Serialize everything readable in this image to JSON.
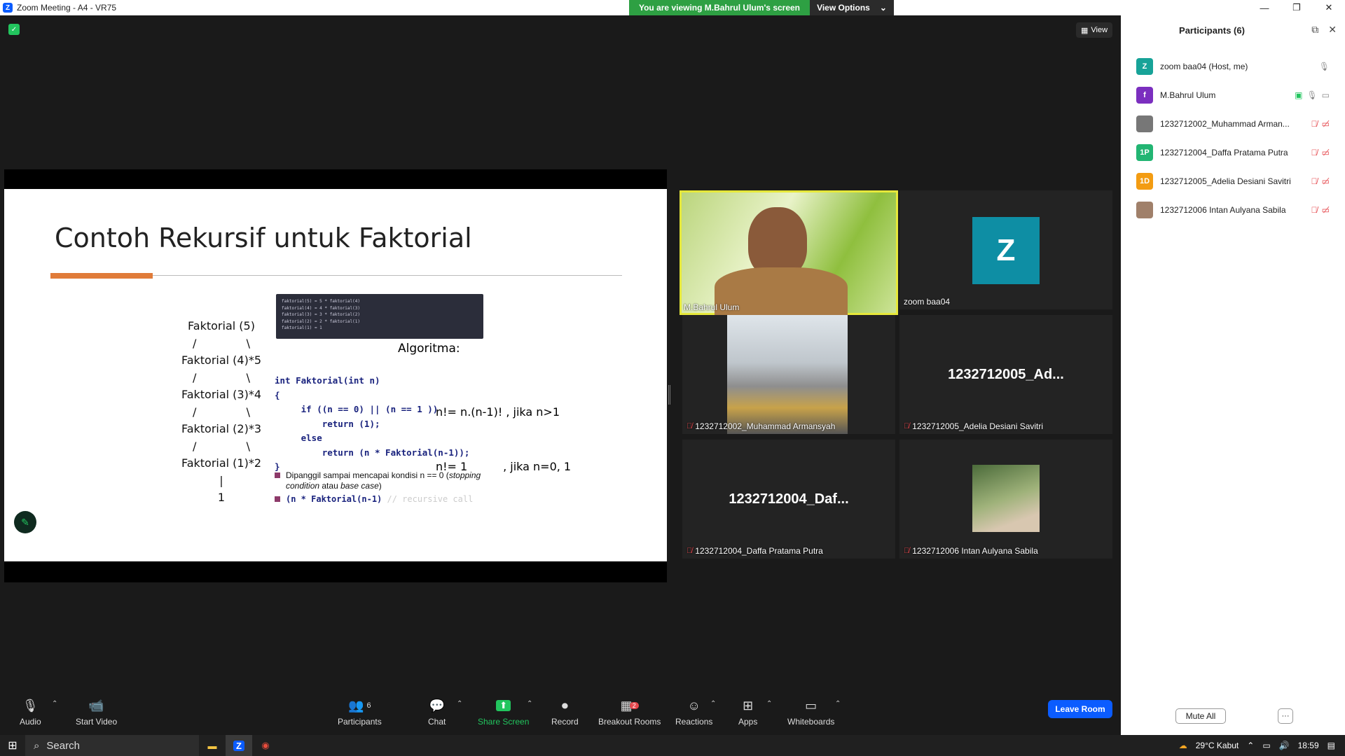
{
  "window": {
    "title": "Zoom Meeting - A4 - VR75",
    "viewing_banner": "You are viewing M.Bahrul Ulum's screen",
    "view_options": "View Options",
    "view_button": "View"
  },
  "slide": {
    "title": "Contoh Rekursif untuk Faktorial",
    "tree": [
      "Faktorial (5)",
      "/              \\",
      "Faktorial (4)*5",
      "/              \\",
      "Faktorial (3)*4",
      "/              \\",
      "Faktorial (2)*3",
      "/              \\",
      "Faktorial (1)*2",
      "|",
      "1"
    ],
    "code_image_lines": [
      "faktorial(5) = 5 * faktorial(4)",
      "faktorial(4) = 4 * faktorial(3)",
      "faktorial(3) = 3 * faktorial(2)",
      "faktorial(2) = 2 * faktorial(1)",
      "faktorial(1) = 1"
    ],
    "algoritma": "Algoritma:",
    "formula_1": "n!= n.(n-1)! , jika n>1",
    "formula_2": "n!= 1          , jika n=0, 1",
    "code": "int Faktorial(int n)\n{\n     if ((n == 0) || (n == 1 ))\n         return (1);\n     else\n         return (n * Faktorial(n-1));\n}",
    "bullet_1_a": "Dipanggil sampai mencapai kondisi n == 0 (",
    "bullet_1_b": "stopping condition",
    "bullet_1_c": " atau ",
    "bullet_1_d": "base case",
    "bullet_1_e": ")",
    "bullet_2_code": "(n * Faktorial(n-1)",
    "bullet_2_comment": " // recursive call"
  },
  "tiles": [
    {
      "name": "M.Bahrul Ulum",
      "muted": false
    },
    {
      "name": "zoom baa04",
      "muted": false,
      "initial": "Z"
    },
    {
      "name": "1232712002_Muhammad Armansyah",
      "muted": true
    },
    {
      "name": "1232712005_Adelia Desiani Savitri",
      "muted": true,
      "big": "1232712005_Ad..."
    },
    {
      "name": "1232712004_Daffa Pratama Putra",
      "muted": true,
      "big": "1232712004_Daf..."
    },
    {
      "name": "1232712006 Intan Aulyana Sabila",
      "muted": true
    }
  ],
  "toolbar": {
    "audio": "Audio",
    "start_video": "Start Video",
    "participants": "Participants",
    "participants_count": "6",
    "chat": "Chat",
    "share_screen": "Share Screen",
    "record": "Record",
    "breakout_rooms": "Breakout Rooms",
    "breakout_badge": "2",
    "reactions": "Reactions",
    "apps": "Apps",
    "whiteboards": "Whiteboards",
    "leave": "Leave Room"
  },
  "panel": {
    "title": "Participants (6)",
    "mute_all": "Mute All",
    "more": "···",
    "participants": [
      {
        "name": "zoom baa04 (Host, me)",
        "initial": "Z",
        "color": "#17a398"
      },
      {
        "name": "M.Bahrul Ulum",
        "initial": "f",
        "color": "#7b2fbf"
      },
      {
        "name": "1232712002_Muhammad Arman...",
        "initial": "",
        "color": "#777"
      },
      {
        "name": "1232712004_Daffa Pratama Putra",
        "initial": "1P",
        "color": "#22b573"
      },
      {
        "name": "1232712005_Adelia Desiani Savitri",
        "initial": "1D",
        "color": "#f39c12"
      },
      {
        "name": "1232712006 Intan Aulyana Sabila",
        "initial": "",
        "color": "#a0806a"
      }
    ]
  },
  "taskbar": {
    "search": "Search",
    "weather": "29°C  Kabut",
    "time": "18:59"
  },
  "colors": {
    "accent": "#0b5cff",
    "active_speaker": "#e6e83a",
    "viewing_banner": "#2ea043",
    "slide_bar": "#e07b39"
  }
}
